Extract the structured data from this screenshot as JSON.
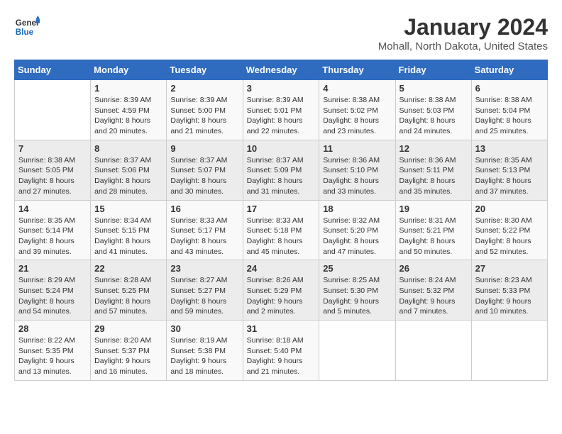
{
  "logo": {
    "line1": "General",
    "line2": "Blue"
  },
  "title": "January 2024",
  "subtitle": "Mohall, North Dakota, United States",
  "days_of_week": [
    "Sunday",
    "Monday",
    "Tuesday",
    "Wednesday",
    "Thursday",
    "Friday",
    "Saturday"
  ],
  "weeks": [
    [
      {
        "day": "",
        "info": ""
      },
      {
        "day": "1",
        "info": "Sunrise: 8:39 AM\nSunset: 4:59 PM\nDaylight: 8 hours\nand 20 minutes."
      },
      {
        "day": "2",
        "info": "Sunrise: 8:39 AM\nSunset: 5:00 PM\nDaylight: 8 hours\nand 21 minutes."
      },
      {
        "day": "3",
        "info": "Sunrise: 8:39 AM\nSunset: 5:01 PM\nDaylight: 8 hours\nand 22 minutes."
      },
      {
        "day": "4",
        "info": "Sunrise: 8:38 AM\nSunset: 5:02 PM\nDaylight: 8 hours\nand 23 minutes."
      },
      {
        "day": "5",
        "info": "Sunrise: 8:38 AM\nSunset: 5:03 PM\nDaylight: 8 hours\nand 24 minutes."
      },
      {
        "day": "6",
        "info": "Sunrise: 8:38 AM\nSunset: 5:04 PM\nDaylight: 8 hours\nand 25 minutes."
      }
    ],
    [
      {
        "day": "7",
        "info": "Sunrise: 8:38 AM\nSunset: 5:05 PM\nDaylight: 8 hours\nand 27 minutes."
      },
      {
        "day": "8",
        "info": "Sunrise: 8:37 AM\nSunset: 5:06 PM\nDaylight: 8 hours\nand 28 minutes."
      },
      {
        "day": "9",
        "info": "Sunrise: 8:37 AM\nSunset: 5:07 PM\nDaylight: 8 hours\nand 30 minutes."
      },
      {
        "day": "10",
        "info": "Sunrise: 8:37 AM\nSunset: 5:09 PM\nDaylight: 8 hours\nand 31 minutes."
      },
      {
        "day": "11",
        "info": "Sunrise: 8:36 AM\nSunset: 5:10 PM\nDaylight: 8 hours\nand 33 minutes."
      },
      {
        "day": "12",
        "info": "Sunrise: 8:36 AM\nSunset: 5:11 PM\nDaylight: 8 hours\nand 35 minutes."
      },
      {
        "day": "13",
        "info": "Sunrise: 8:35 AM\nSunset: 5:13 PM\nDaylight: 8 hours\nand 37 minutes."
      }
    ],
    [
      {
        "day": "14",
        "info": "Sunrise: 8:35 AM\nSunset: 5:14 PM\nDaylight: 8 hours\nand 39 minutes."
      },
      {
        "day": "15",
        "info": "Sunrise: 8:34 AM\nSunset: 5:15 PM\nDaylight: 8 hours\nand 41 minutes."
      },
      {
        "day": "16",
        "info": "Sunrise: 8:33 AM\nSunset: 5:17 PM\nDaylight: 8 hours\nand 43 minutes."
      },
      {
        "day": "17",
        "info": "Sunrise: 8:33 AM\nSunset: 5:18 PM\nDaylight: 8 hours\nand 45 minutes."
      },
      {
        "day": "18",
        "info": "Sunrise: 8:32 AM\nSunset: 5:20 PM\nDaylight: 8 hours\nand 47 minutes."
      },
      {
        "day": "19",
        "info": "Sunrise: 8:31 AM\nSunset: 5:21 PM\nDaylight: 8 hours\nand 50 minutes."
      },
      {
        "day": "20",
        "info": "Sunrise: 8:30 AM\nSunset: 5:22 PM\nDaylight: 8 hours\nand 52 minutes."
      }
    ],
    [
      {
        "day": "21",
        "info": "Sunrise: 8:29 AM\nSunset: 5:24 PM\nDaylight: 8 hours\nand 54 minutes."
      },
      {
        "day": "22",
        "info": "Sunrise: 8:28 AM\nSunset: 5:25 PM\nDaylight: 8 hours\nand 57 minutes."
      },
      {
        "day": "23",
        "info": "Sunrise: 8:27 AM\nSunset: 5:27 PM\nDaylight: 8 hours\nand 59 minutes."
      },
      {
        "day": "24",
        "info": "Sunrise: 8:26 AM\nSunset: 5:29 PM\nDaylight: 9 hours\nand 2 minutes."
      },
      {
        "day": "25",
        "info": "Sunrise: 8:25 AM\nSunset: 5:30 PM\nDaylight: 9 hours\nand 5 minutes."
      },
      {
        "day": "26",
        "info": "Sunrise: 8:24 AM\nSunset: 5:32 PM\nDaylight: 9 hours\nand 7 minutes."
      },
      {
        "day": "27",
        "info": "Sunrise: 8:23 AM\nSunset: 5:33 PM\nDaylight: 9 hours\nand 10 minutes."
      }
    ],
    [
      {
        "day": "28",
        "info": "Sunrise: 8:22 AM\nSunset: 5:35 PM\nDaylight: 9 hours\nand 13 minutes."
      },
      {
        "day": "29",
        "info": "Sunrise: 8:20 AM\nSunset: 5:37 PM\nDaylight: 9 hours\nand 16 minutes."
      },
      {
        "day": "30",
        "info": "Sunrise: 8:19 AM\nSunset: 5:38 PM\nDaylight: 9 hours\nand 18 minutes."
      },
      {
        "day": "31",
        "info": "Sunrise: 8:18 AM\nSunset: 5:40 PM\nDaylight: 9 hours\nand 21 minutes."
      },
      {
        "day": "",
        "info": ""
      },
      {
        "day": "",
        "info": ""
      },
      {
        "day": "",
        "info": ""
      }
    ]
  ]
}
